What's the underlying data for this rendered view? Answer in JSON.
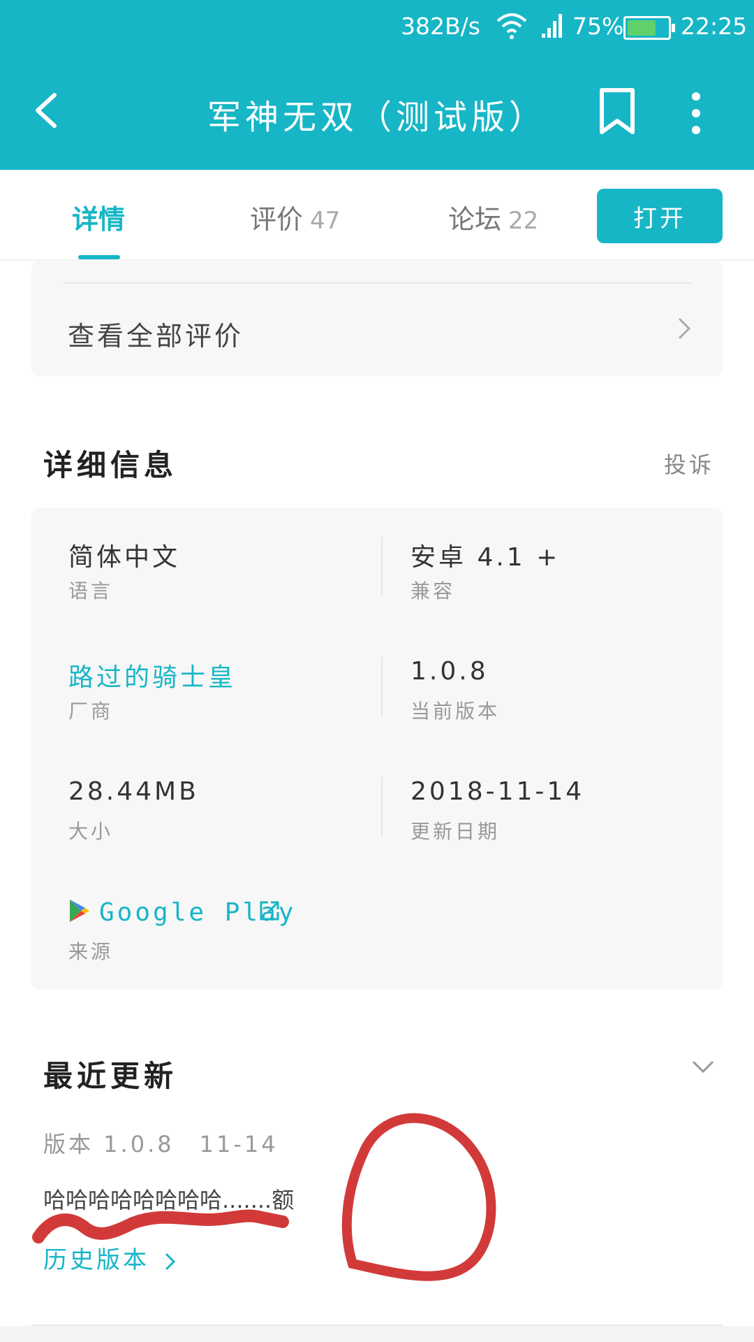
{
  "status_bar": {
    "net_speed": "382B/s",
    "battery_percent": "75%",
    "time": "22:25",
    "battery_level": 0.75
  },
  "app_bar": {
    "title": "军神无双（测试版）",
    "icons": [
      "back-arrow-icon",
      "bookmark-icon",
      "more-vert-icon"
    ]
  },
  "tabs": {
    "items": [
      {
        "label": "详情",
        "count": ""
      },
      {
        "label": "评价",
        "count": "47"
      },
      {
        "label": "论坛",
        "count": "22"
      }
    ],
    "open_button": "打开"
  },
  "reviews": {
    "view_all": "查看全部评价"
  },
  "details": {
    "title": "详细信息",
    "report": "投诉",
    "cells": [
      {
        "value": "简体中文",
        "label": "语言"
      },
      {
        "value": "安卓 4.1 +",
        "label": "兼容"
      },
      {
        "value": "路过的骑士皇",
        "label": "厂商"
      },
      {
        "value": "1.0.8",
        "label": "当前版本"
      },
      {
        "value": "28.44MB",
        "label": "大小"
      },
      {
        "value": "2018-11-14",
        "label": "更新日期"
      }
    ],
    "source": {
      "value": "Google Play",
      "label": "来源"
    }
  },
  "recent_update": {
    "title": "最近更新",
    "version": "版本 1.0.8",
    "date": "11-14",
    "notes": "哈哈哈哈哈哈哈哈.......额",
    "history_link": "历史版本"
  },
  "colors": {
    "accent": "#16b6c6",
    "annotation_red": "#d23a3a"
  }
}
